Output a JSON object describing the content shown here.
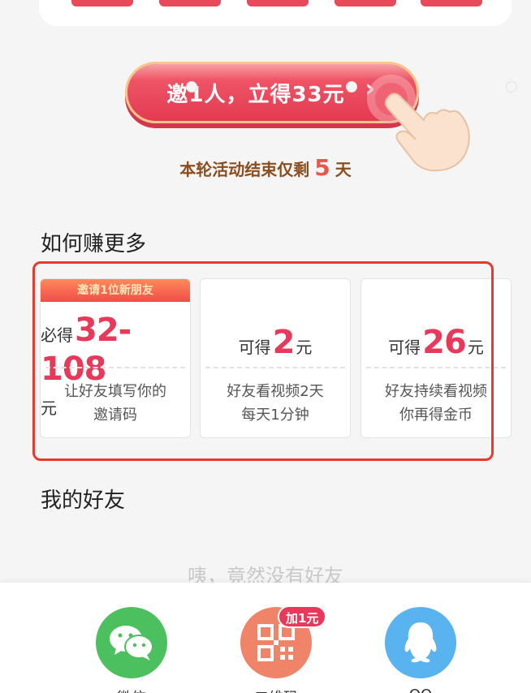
{
  "invite": {
    "button_label": "邀1人，立得33元",
    "chevron": "›"
  },
  "countdown": {
    "prefix": "本轮活动结束仅剩",
    "days": "5",
    "suffix": "天"
  },
  "how_to_earn": {
    "title": "如何赚更多",
    "cards": [
      {
        "ribbon": "邀请1位新朋友",
        "prefix": "必得",
        "amount": "32-108",
        "unit": "元",
        "desc_line1": "让好友填写你的",
        "desc_line2": "邀请码"
      },
      {
        "prefix": "可得",
        "amount": "2",
        "unit": "元",
        "desc_line1": "好友看视频2天",
        "desc_line2": "每天1分钟"
      },
      {
        "prefix": "可得",
        "amount": "26",
        "unit": "元",
        "desc_line1": "好友持续看视频",
        "desc_line2": "你再得金币"
      }
    ]
  },
  "friends": {
    "title": "我的好友",
    "empty_text": "咦，竟然没有好友"
  },
  "share": {
    "items": [
      {
        "label": "微信",
        "icon": "wechat-icon",
        "color": "#4cbf5f"
      },
      {
        "label": "二维码",
        "icon": "qrcode-icon",
        "color": "#f08468",
        "badge": "加1元"
      },
      {
        "label": "QQ",
        "icon": "qq-icon",
        "color": "#59b3ef"
      }
    ]
  },
  "colors": {
    "accent": "#e8395b",
    "highlight_border": "#e8392f",
    "countdown_text": "#8a4e1e"
  }
}
